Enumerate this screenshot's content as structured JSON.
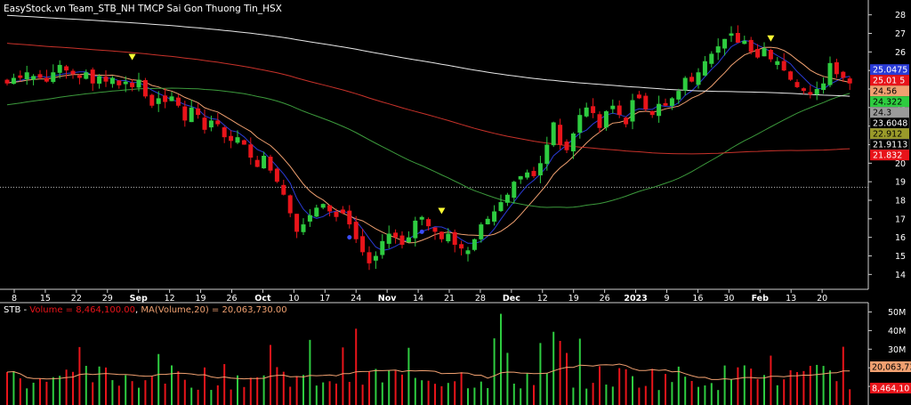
{
  "colors": {
    "background": "#000000",
    "text": "#ffffff",
    "up": "#2ecc40",
    "down": "#e8141a",
    "ma_blue": "#2a3bd6",
    "ma_orange": "#f0a070",
    "ma_green": "#3c9a3c",
    "ma_red": "#c8322a",
    "ma_white": "#e8e8e8",
    "marker": "#ffff33",
    "volume_ma": "#f0a070"
  },
  "chart_data": [
    {
      "type": "candlestick",
      "title": "EasyStock.vn Team_STB_NH TMCP Sai Gon Thuong Tin_HSX",
      "ylim": [
        13.2,
        28.8
      ],
      "y_ticks": [
        14,
        15,
        16,
        17,
        18,
        19,
        20,
        21,
        22,
        23,
        24,
        25,
        26,
        27,
        28
      ],
      "x_ticks": [
        {
          "label": "8",
          "bold": false
        },
        {
          "label": "15",
          "bold": false
        },
        {
          "label": "22",
          "bold": false
        },
        {
          "label": "29",
          "bold": false
        },
        {
          "label": "Sep",
          "bold": true
        },
        {
          "label": "12",
          "bold": false
        },
        {
          "label": "19",
          "bold": false
        },
        {
          "label": "26",
          "bold": false
        },
        {
          "label": "Oct",
          "bold": true
        },
        {
          "label": "10",
          "bold": false
        },
        {
          "label": "17",
          "bold": false
        },
        {
          "label": "24",
          "bold": false
        },
        {
          "label": "Nov",
          "bold": true
        },
        {
          "label": "14",
          "bold": false
        },
        {
          "label": "21",
          "bold": false
        },
        {
          "label": "28",
          "bold": false
        },
        {
          "label": "Dec",
          "bold": true
        },
        {
          "label": "12",
          "bold": false
        },
        {
          "label": "19",
          "bold": false
        },
        {
          "label": "26",
          "bold": false
        },
        {
          "label": "2023",
          "bold": true
        },
        {
          "label": "9",
          "bold": false
        },
        {
          "label": "16",
          "bold": false
        },
        {
          "label": "30",
          "bold": false
        },
        {
          "label": "Feb",
          "bold": true
        },
        {
          "label": "13",
          "bold": false
        },
        {
          "label": "20",
          "bold": false
        }
      ],
      "reference_level": 18.7,
      "closes": [
        24.3,
        24.6,
        24.6,
        24.9,
        24.7,
        24.6,
        24.4,
        24.9,
        25.3,
        25.0,
        24.8,
        24.6,
        24.9,
        24.3,
        24.7,
        24.4,
        24.6,
        24.2,
        24.4,
        24.1,
        24.5,
        23.6,
        23.1,
        23.5,
        23.3,
        23.6,
        23.1,
        22.3,
        23.0,
        22.6,
        21.8,
        22.3,
        22.1,
        21.4,
        21.2,
        21.4,
        21.0,
        20.3,
        19.8,
        20.4,
        19.6,
        19.0,
        18.3,
        17.3,
        16.3,
        16.7,
        17.2,
        17.6,
        17.8,
        17.4,
        17.1,
        17.3,
        16.7,
        15.9,
        15.2,
        14.6,
        15.0,
        15.8,
        16.2,
        16.0,
        15.6,
        16.0,
        16.9,
        17.1,
        16.6,
        16.3,
        15.9,
        16.2,
        15.6,
        15.4,
        15.3,
        15.9,
        16.7,
        17.0,
        17.4,
        17.9,
        18.3,
        19.0,
        19.3,
        19.5,
        19.3,
        20.0,
        21.0,
        22.2,
        21.0,
        20.7,
        21.6,
        22.6,
        23.0,
        22.7,
        21.9,
        22.8,
        23.1,
        22.6,
        22.1,
        23.4,
        23.5,
        22.9,
        22.6,
        23.2,
        23.1,
        23.5,
        23.9,
        24.6,
        24.4,
        24.9,
        25.5,
        25.9,
        26.3,
        26.7,
        27.0,
        26.5,
        26.6,
        26.0,
        25.7,
        26.2,
        25.6,
        25.5,
        25.0,
        24.5,
        24.1,
        23.9,
        23.7,
        24.0,
        24.3,
        25.4,
        24.8,
        24.6,
        24.3
      ],
      "markers": [
        {
          "index": 19,
          "y": 25.7
        },
        {
          "index": 66,
          "y": 17.4
        },
        {
          "index": 116,
          "y": 26.7
        }
      ],
      "moving_averages": [
        {
          "color_key": "ma_blue",
          "value": 25.0475
        },
        {
          "color_key": "ma_orange",
          "value": 25.0135
        },
        {
          "color_key": "ma_red",
          "value": 24.56
        },
        {
          "color_key": "ma_green",
          "value": 24.322
        },
        {
          "color_key": "ma_white",
          "value": 24.3
        },
        {
          "color_key": "ma_green",
          "value": 23.6048
        },
        {
          "color_key": "ma_orange",
          "value": 22.912
        },
        {
          "color_key": "ma_white",
          "value": 21.9113
        },
        {
          "color_key": "ma_red",
          "value": 21.832
        }
      ],
      "price_labels": [
        {
          "text": "25.0475",
          "value": 25.0475,
          "bg": "#2a3bd6",
          "fg": "#ffffff"
        },
        {
          "text": "25.01 5",
          "value": 25.01,
          "bg": "#e8141a",
          "fg": "#ffffff"
        },
        {
          "text": "24.56",
          "value": 24.56,
          "bg": "#f0a070",
          "fg": "#000000"
        },
        {
          "text": "24.322",
          "value": 24.322,
          "bg": "#2ecc40",
          "fg": "#000000"
        },
        {
          "text": "24.3",
          "value": 24.3,
          "bg": "#9a9a9a",
          "fg": "#000000"
        },
        {
          "text": "23.6048",
          "value": 23.6048,
          "bg": "#000000",
          "fg": "#ffffff"
        },
        {
          "text": "22.912",
          "value": 22.912,
          "bg": "#9a9a2a",
          "fg": "#000000"
        },
        {
          "text": "21.9113",
          "value": 21.9113,
          "bg": "#000000",
          "fg": "#ffffff"
        },
        {
          "text": "21.832",
          "value": 21.832,
          "bg": "#e8141a",
          "fg": "#ffffff"
        }
      ]
    },
    {
      "type": "bar",
      "title_prefix": "STB - ",
      "series_label": "Volume = 8,464,100.00",
      "separator": ", ",
      "ma_label": "MA(Volume,20) = 20,063,730.00",
      "ylim": [
        0,
        55000000
      ],
      "y_ticks": [
        {
          "label": "50M",
          "value": 50000000
        },
        {
          "label": "40M",
          "value": 40000000
        },
        {
          "label": "30M",
          "value": 30000000
        },
        {
          "label": "20M",
          "value": 20000000
        },
        {
          "label": "10M",
          "value": 10000000
        }
      ],
      "ma_value_label": "20,063,73",
      "last_value_label": "8,464,10",
      "ma_last": 20063730,
      "last_volume": 8464100
    }
  ]
}
